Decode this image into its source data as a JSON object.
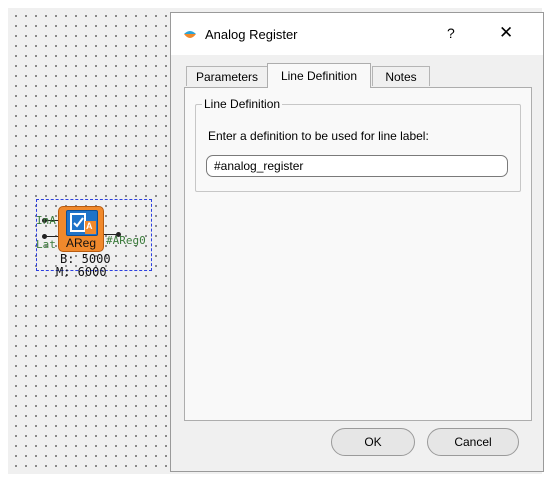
{
  "canvas": {
    "block": {
      "name": "AReg",
      "inputs": [
        "InA",
        "Lat"
      ],
      "output": "#AReg0",
      "params": [
        "B: 5000",
        "M: 6000"
      ],
      "icon_letter": "A"
    }
  },
  "dialog": {
    "title": "Analog Register",
    "help_label": "?",
    "close_label": "✕",
    "tabs": [
      {
        "label": "Parameters",
        "active": false
      },
      {
        "label": "Line Definition",
        "active": true
      },
      {
        "label": "Notes",
        "active": false
      }
    ],
    "group": {
      "title": "Line Definition",
      "prompt": "Enter a definition to be used for line label:",
      "value": "#analog_register"
    },
    "buttons": {
      "ok": "OK",
      "cancel": "Cancel"
    }
  }
}
